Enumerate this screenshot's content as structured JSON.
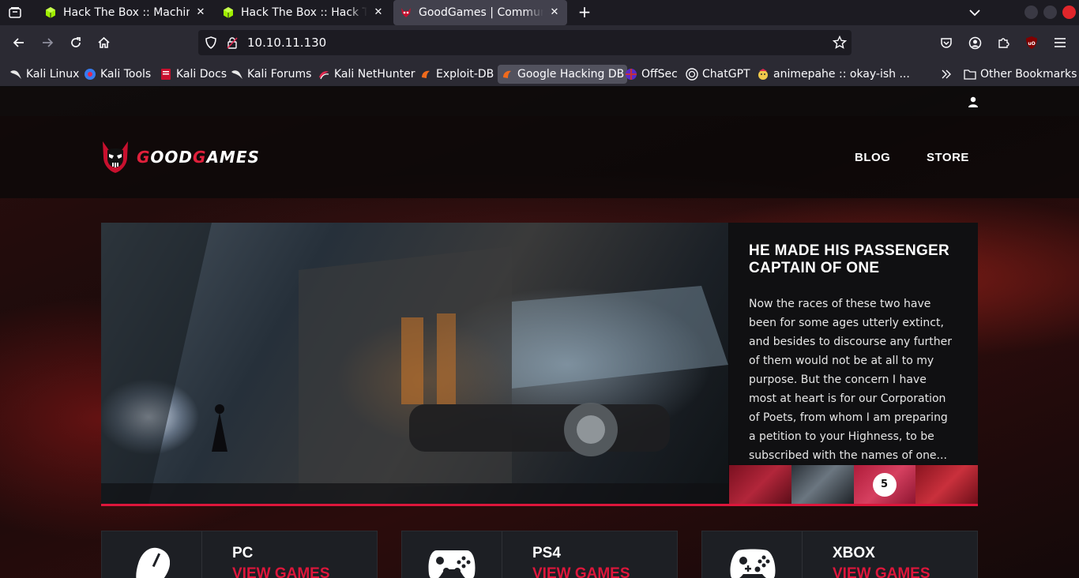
{
  "browser": {
    "tabs": [
      {
        "title": "Hack The Box :: Machines",
        "icon": "htb-cube-icon",
        "active": false
      },
      {
        "title": "Hack The Box :: Hack The B",
        "icon": "htb-cube-icon",
        "active": false
      },
      {
        "title": "GoodGames | Community and",
        "icon": "goodgames-skull-icon",
        "active": true
      }
    ],
    "url": "10.10.11.130",
    "bookmarks": [
      {
        "label": "Kali Linux",
        "icon": "kali-dragon-icon"
      },
      {
        "label": "Kali Tools",
        "icon": "kali-tools-icon"
      },
      {
        "label": "Kali Docs",
        "icon": "kali-docs-icon"
      },
      {
        "label": "Kali Forums",
        "icon": "kali-dragon-icon"
      },
      {
        "label": "Kali NetHunter",
        "icon": "nethunter-icon"
      },
      {
        "label": "Exploit-DB",
        "icon": "exploitdb-icon"
      },
      {
        "label": "Google Hacking DB",
        "icon": "ghdb-icon"
      },
      {
        "label": "OffSec",
        "icon": "offsec-icon"
      },
      {
        "label": "ChatGPT",
        "icon": "chatgpt-icon"
      },
      {
        "label": "animepahe :: okay-ish ...",
        "icon": "animepahe-icon"
      }
    ],
    "other_bookmarks": "Other Bookmarks"
  },
  "site": {
    "logo_prefix": "G",
    "logo_mid": "OOD",
    "logo_g2": "G",
    "logo_suffix": "AMES",
    "menu": [
      "BLOG",
      "STORE"
    ],
    "slide": {
      "title": "HE MADE HIS PASSENGER CAPTAIN OF ONE",
      "body": "Now the races of these two have been for some ages utterly extinct, and besides to discourse any further of them would not be at all to my purpose. But the concern I have most at heart is for our Corporation of Poets, from whom I am preparing a petition to your Highness, to be subscribed with the names of one...",
      "badge": "5"
    },
    "categories": [
      {
        "title": "PC",
        "link": "VIEW GAMES",
        "icon": "mouse-icon"
      },
      {
        "title": "PS4",
        "link": "VIEW GAMES",
        "icon": "gamepad-icon"
      },
      {
        "title": "XBOX",
        "link": "VIEW GAMES",
        "icon": "xbox-controller-icon"
      }
    ]
  }
}
